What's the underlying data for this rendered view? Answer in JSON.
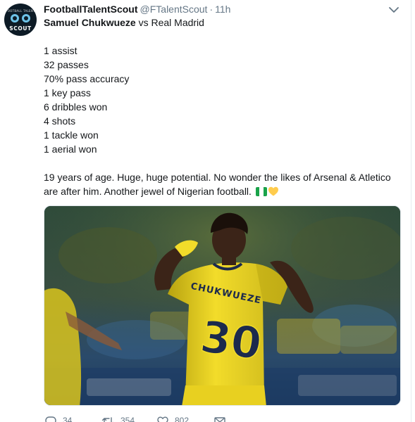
{
  "author": {
    "display_name": "FootballTalentScout",
    "handle": "@FTalentScout",
    "separator": "·",
    "time": "11h",
    "avatar": {
      "top_text": "FOOTBALL TALENT",
      "main_text": "SCOUT",
      "icon": "soccer-ball-icon"
    }
  },
  "tweet": {
    "subject_name": "Samuel Chukwueze",
    "subject_rest": " vs Real Madrid",
    "stats": [
      "1 assist",
      "32 passes",
      "70% pass accuracy",
      "1 key pass",
      "6 dribbles won",
      "4 shots",
      "1 tackle won",
      "1 aerial won"
    ],
    "paragraph_line1": "19 years of age. Huge, huge potential. No wonder the likes of Arsenal & Atletico",
    "paragraph_line2": "are after him. Another jewel of Nigerian football.",
    "emojis": [
      "nigeria-flag-icon",
      "yellow-heart-icon"
    ]
  },
  "media": {
    "jersey_name": "CHUKWUEZE",
    "jersey_number": "30",
    "colors": {
      "kit_yellow": "#f2dc2a",
      "kit_shadow": "#b8a310",
      "number_navy": "#1c2a4d",
      "background": "#1e3340"
    }
  },
  "actions": {
    "reply": {
      "icon": "reply-icon",
      "count": "34"
    },
    "retweet": {
      "icon": "retweet-icon",
      "count": "354"
    },
    "like": {
      "icon": "heart-outline-icon",
      "count": "802"
    },
    "dm": {
      "icon": "envelope-icon"
    }
  },
  "colors": {
    "text": "#14171a",
    "secondary": "#657786",
    "border": "#e1e8ed",
    "nigeria_green": "#1aa34a",
    "heart_yellow": "#ffcc4d"
  }
}
